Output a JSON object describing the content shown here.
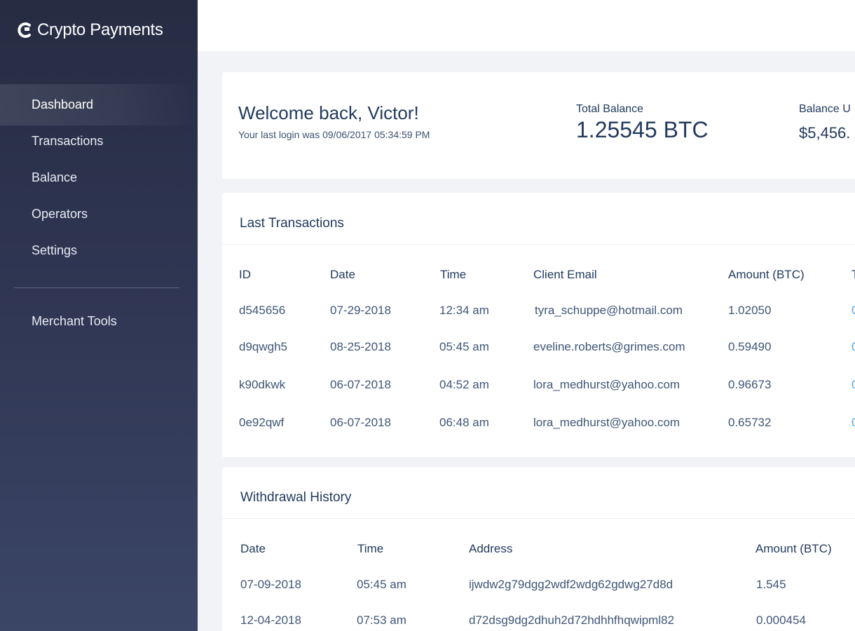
{
  "app": {
    "name": "Crypto Payments"
  },
  "sidebar": {
    "items": [
      {
        "label": "Dashboard"
      },
      {
        "label": "Transactions"
      },
      {
        "label": "Balance"
      },
      {
        "label": "Operators"
      },
      {
        "label": "Settings"
      }
    ],
    "bottom_item": {
      "label": "Merchant Tools"
    }
  },
  "welcome": {
    "title": "Welcome back, Victor!",
    "subtitle": "Your last login was 09/06/2017 05:34:59 PM",
    "total_balance_label": "Total Balance",
    "total_balance_value": "1.25545 BTC",
    "balance_usd_label": "Balance U",
    "balance_usd_value": "$5,456."
  },
  "last_transactions": {
    "title": "Last Transactions",
    "columns": [
      "ID",
      "Date",
      "Time",
      "Client Email",
      "Amount (BTC)",
      "T"
    ],
    "rows": [
      {
        "id": "d545656",
        "date": "07-29-2018",
        "time": "12:34 am",
        "email": "tyra_schuppe@hotmail.com",
        "amount": "1.02050",
        "extra": "0"
      },
      {
        "id": "d9qwgh5",
        "date": "08-25-2018",
        "time": "05:45 am",
        "email": "eveline.roberts@grimes.com",
        "amount": "0.59490",
        "extra": "0"
      },
      {
        "id": "k90dkwk",
        "date": "06-07-2018",
        "time": "04:52 am",
        "email": "lora_medhurst@yahoo.com",
        "amount": "0.96673",
        "extra": "0"
      },
      {
        "id": "0e92qwf",
        "date": "06-07-2018",
        "time": "06:48 am",
        "email": "lora_medhurst@yahoo.com",
        "amount": "0.65732",
        "extra": "0"
      }
    ]
  },
  "withdrawal_history": {
    "title": "Withdrawal History",
    "columns": [
      "Date",
      "Time",
      "Address",
      "Amount (BTC)"
    ],
    "rows": [
      {
        "date": "07-09-2018",
        "time": "05:45 am",
        "address": "ijwdw2g79dgg2wdf2wdg62gdwg27d8d",
        "amount": "1.545"
      },
      {
        "date": "12-04-2018",
        "time": "07:53 am",
        "address": "d72dsg9dg2dhuh2d72hdhhfhqwipml82",
        "amount": "0.000454"
      }
    ]
  },
  "colors": {
    "sidebar": "#2b314a",
    "text_dark": "#223a5e",
    "link": "#4aa3df",
    "background": "#f2f3f7"
  }
}
